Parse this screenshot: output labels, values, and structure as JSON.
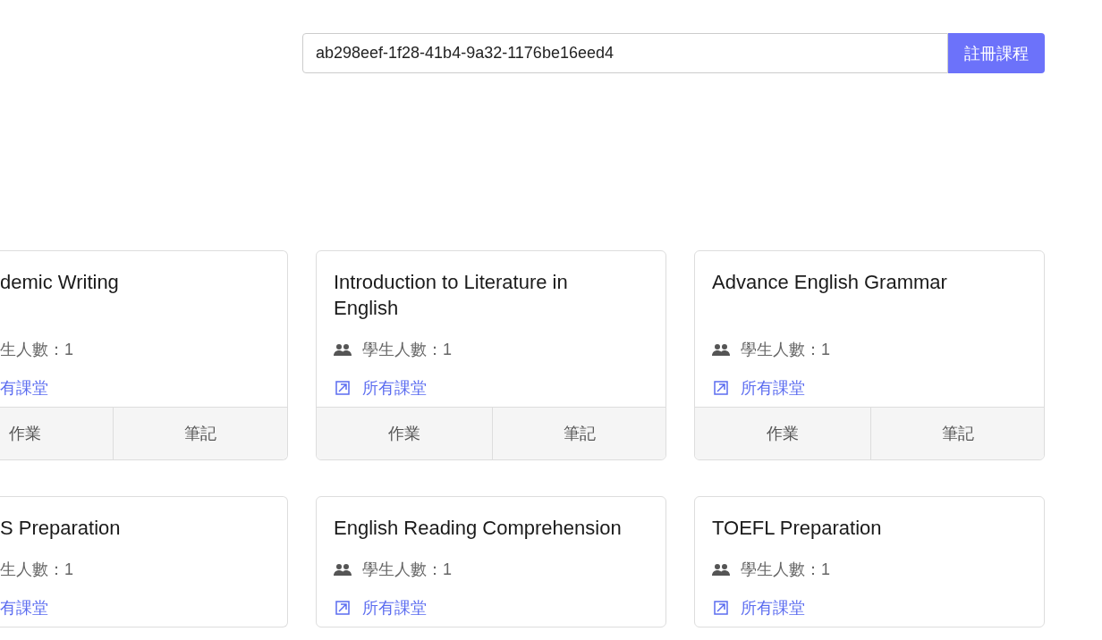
{
  "enroll_form": {
    "code_value": "ab298eef-1f28-41b4-9a32-1176be16eed4",
    "button": "註冊課程"
  },
  "courses": [
    {
      "cut": true,
      "title": "demic Writing",
      "students": "生人數：1",
      "link": "有課堂",
      "actions": [
        "作業",
        "筆記"
      ]
    },
    {
      "cut": false,
      "title": "Introduction to Literature in English",
      "students": "學生人數：1",
      "link": "所有課堂",
      "actions": [
        "作業",
        "筆記"
      ]
    },
    {
      "cut": false,
      "title": "Advance English Grammar",
      "students": "學生人數：1",
      "link": "所有課堂",
      "actions": [
        "作業",
        "筆記"
      ]
    },
    {
      "cut": true,
      "title": "S Preparation",
      "students": "生人數：1",
      "link": "有課堂"
    },
    {
      "cut": false,
      "title": "English Reading Comprehension",
      "students": "學生人數：1",
      "link": "所有課堂"
    },
    {
      "cut": false,
      "title": "TOEFL Preparation",
      "students": "學生人數：1",
      "link": "所有課堂"
    }
  ]
}
